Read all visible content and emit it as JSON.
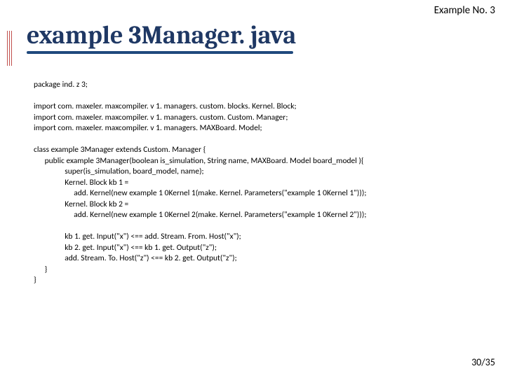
{
  "header_label": "Example No. 3",
  "title": "example 3Manager. java",
  "code": {
    "pkg": "package ind. z 3;",
    "imp1": "import com. maxeler. maxcompiler. v 1. managers. custom. blocks. Kernel. Block;",
    "imp2": "import com. maxeler. maxcompiler. v 1. managers. custom. Custom. Manager;",
    "imp3": "import com. maxeler. maxcompiler. v 1. managers. MAXBoard. Model;",
    "cls": "class example 3Manager extends Custom. Manager {",
    "ctor": "      public example 3Manager(boolean is_simulation, String name, MAXBoard. Model board_model ){",
    "s1": "                 super(is_simulation, board_model, name);",
    "s2": "                 Kernel. Block kb 1 =",
    "s3": "                      add. Kernel(new example 1 0Kernel 1(make. Kernel. Parameters(\"example 1 0Kernel 1\")));",
    "s4": "                 Kernel. Block kb 2 =",
    "s5": "                      add. Kernel(new example 1 0Kernel 2(make. Kernel. Parameters(\"example 1 0Kernel 2\")));",
    "s6": "                 kb 1. get. Input(\"x\") <== add. Stream. From. Host(\"x\");",
    "s7": "                 kb 2. get. Input(\"x\") <== kb 1. get. Output(\"z\");",
    "s8": "                 add. Stream. To. Host(\"z\") <== kb 2. get. Output(\"z\");",
    "cl1": "      }",
    "cl2": "}"
  },
  "pager": "30/35"
}
